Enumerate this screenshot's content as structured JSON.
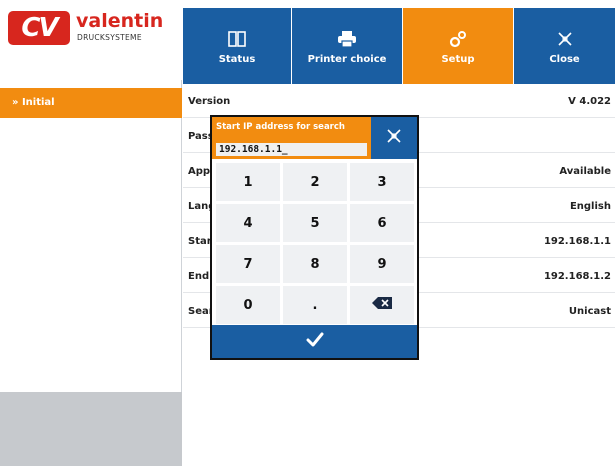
{
  "logo": {
    "mark": "CV",
    "name": "valentin",
    "sub": "DRUCKSYSTEME"
  },
  "nav": [
    {
      "label": "Status",
      "icon": "book-icon"
    },
    {
      "label": "Printer choice",
      "icon": "printer-icon"
    },
    {
      "label": "Setup",
      "icon": "gears-icon"
    },
    {
      "label": "Close",
      "icon": "close-icon"
    }
  ],
  "sidebar": {
    "items": [
      {
        "label": "» Initial"
      }
    ]
  },
  "rows": [
    {
      "key": "Version",
      "value": "V 4.022"
    },
    {
      "key": "Pass",
      "value": ""
    },
    {
      "key": "Appl",
      "value": "Available"
    },
    {
      "key": "Lang",
      "value": "English"
    },
    {
      "key": "Start",
      "value": "192.168.1.1"
    },
    {
      "key": "End",
      "value": "192.168.1.2"
    },
    {
      "key": "Sear",
      "value": "Unicast"
    }
  ],
  "dialog": {
    "title": "Start IP address for search",
    "value": "192.168.1.1_",
    "keys": [
      "1",
      "2",
      "3",
      "4",
      "5",
      "6",
      "7",
      "8",
      "9",
      "0",
      "."
    ],
    "backspace_icon": "backspace-icon",
    "ok_icon": "check-icon",
    "close_icon": "close-icon"
  },
  "colors": {
    "blue": "#1a5ea2",
    "orange": "#f28c10",
    "red": "#d7261e",
    "gray": "#c6c9cd"
  }
}
